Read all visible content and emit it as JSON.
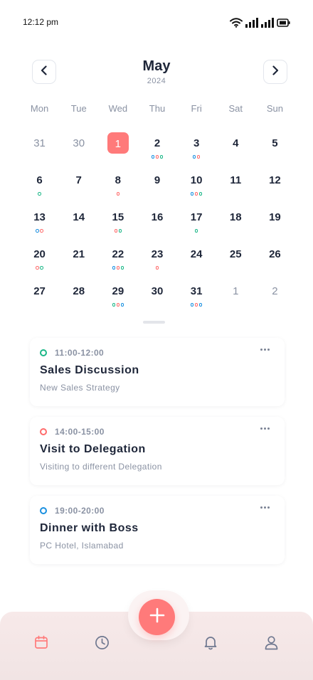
{
  "status_bar": {
    "time": "12:12 pm"
  },
  "calendar": {
    "month": "May",
    "year": "2024",
    "weekdays": [
      "Mon",
      "Tue",
      "Wed",
      "Thu",
      "Fri",
      "Sat",
      "Sun"
    ],
    "days": [
      {
        "n": "31",
        "muted": true,
        "dots": []
      },
      {
        "n": "30",
        "muted": true,
        "dots": []
      },
      {
        "n": "1",
        "selected": true,
        "dots": []
      },
      {
        "n": "2",
        "dots": [
          "blue",
          "red",
          "green"
        ]
      },
      {
        "n": "3",
        "dots": [
          "blue",
          "red"
        ]
      },
      {
        "n": "4",
        "dots": []
      },
      {
        "n": "5",
        "dots": []
      },
      {
        "n": "6",
        "dots": [
          "green"
        ]
      },
      {
        "n": "7",
        "dots": []
      },
      {
        "n": "8",
        "dots": [
          "red"
        ]
      },
      {
        "n": "9",
        "dots": []
      },
      {
        "n": "10",
        "dots": [
          "blue",
          "red",
          "green"
        ]
      },
      {
        "n": "11",
        "dots": []
      },
      {
        "n": "12",
        "dots": []
      },
      {
        "n": "13",
        "dots": [
          "blue",
          "red"
        ]
      },
      {
        "n": "14",
        "dots": []
      },
      {
        "n": "15",
        "dots": [
          "red",
          "green"
        ]
      },
      {
        "n": "16",
        "dots": []
      },
      {
        "n": "17",
        "dots": [
          "green"
        ]
      },
      {
        "n": "18",
        "dots": []
      },
      {
        "n": "19",
        "dots": []
      },
      {
        "n": "20",
        "dots": [
          "red",
          "green"
        ]
      },
      {
        "n": "21",
        "dots": []
      },
      {
        "n": "22",
        "dots": [
          "blue",
          "red",
          "green"
        ]
      },
      {
        "n": "23",
        "dots": [
          "red"
        ]
      },
      {
        "n": "24",
        "dots": []
      },
      {
        "n": "25",
        "dots": []
      },
      {
        "n": "26",
        "dots": []
      },
      {
        "n": "27",
        "dots": []
      },
      {
        "n": "28",
        "dots": []
      },
      {
        "n": "29",
        "dots": [
          "green",
          "red",
          "blue"
        ]
      },
      {
        "n": "30",
        "dots": []
      },
      {
        "n": "31",
        "dots": [
          "blue",
          "red",
          "blue"
        ]
      },
      {
        "n": "1",
        "muted": true,
        "dots": []
      },
      {
        "n": "2",
        "muted": true,
        "dots": []
      }
    ]
  },
  "events": [
    {
      "time": "11:00-12:00",
      "title": "Sales Discussion",
      "subtitle": "New Sales Strategy",
      "color": "#1bb787"
    },
    {
      "time": "14:00-15:00",
      "title": "Visit to Delegation",
      "subtitle": "Visiting to different Delegation",
      "color": "#ff6b6b"
    },
    {
      "time": "19:00-20:00",
      "title": "Dinner with Boss",
      "subtitle": "PC Hotel, Islamabad",
      "color": "#1a90e0"
    }
  ],
  "colors": {
    "accent": "#ff7a7a",
    "text_primary": "#1e2639",
    "text_muted": "#8a92a3",
    "dot_green": "#1bb787",
    "dot_red": "#ff6b6b",
    "dot_blue": "#1a90e0",
    "nav_bg": "#f3e6e6"
  },
  "bottom_nav": {
    "items": [
      {
        "icon": "calendar-icon",
        "active": true
      },
      {
        "icon": "clock-icon",
        "active": false
      },
      {
        "icon": "bell-icon",
        "active": false
      },
      {
        "icon": "user-icon",
        "active": false
      }
    ],
    "fab_icon": "plus-icon"
  }
}
